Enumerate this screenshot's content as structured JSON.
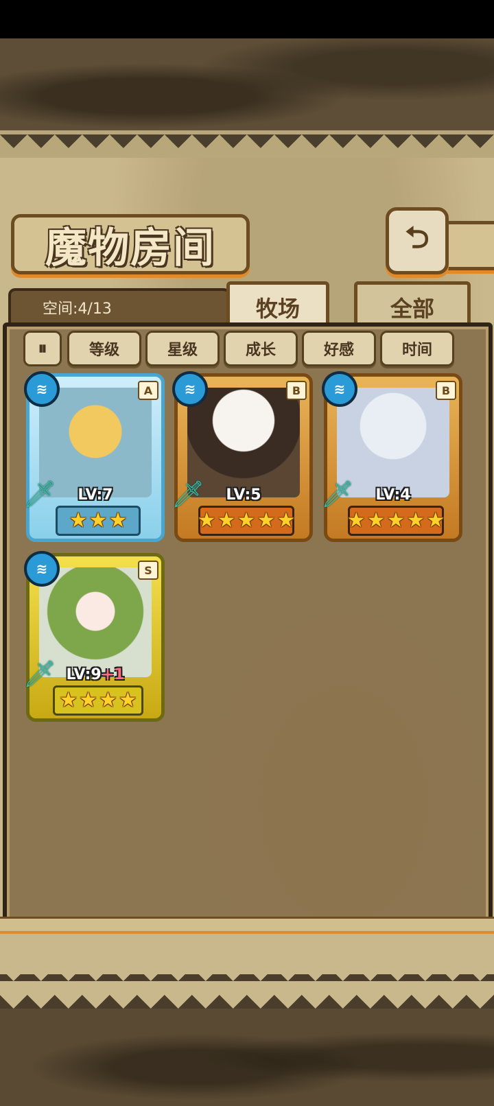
{
  "page": {
    "title": "魔物房间",
    "capacity": "空间:4/13",
    "back_icon": "back-arrow-icon"
  },
  "tabs": [
    {
      "label": "牧场",
      "active": true
    },
    {
      "label": "全部",
      "active": false
    }
  ],
  "sort": {
    "toggle_icon": "sort-toggle-icon",
    "buttons": [
      "等级",
      "星级",
      "成长",
      "好感",
      "时间"
    ]
  },
  "monsters": [
    {
      "rank": "A",
      "level": "LV:7",
      "level_bonus": "",
      "stars": 3,
      "element_icon": "water-element-icon",
      "type_icon": "sword-icon",
      "frame_color": "#4aa6cf"
    },
    {
      "rank": "B",
      "level": "LV:5",
      "level_bonus": "",
      "stars": 5,
      "element_icon": "water-element-icon",
      "type_icon": "sword-icon",
      "frame_color": "#c47a22"
    },
    {
      "rank": "B",
      "level": "LV:4",
      "level_bonus": "",
      "stars": 5,
      "element_icon": "water-element-icon",
      "type_icon": "sword-icon",
      "frame_color": "#c47a22"
    },
    {
      "rank": "S",
      "level": "LV:9",
      "level_bonus": "+1",
      "stars": 4,
      "element_icon": "water-element-icon",
      "type_icon": "sword-icon",
      "frame_color": "#c8a914"
    }
  ]
}
